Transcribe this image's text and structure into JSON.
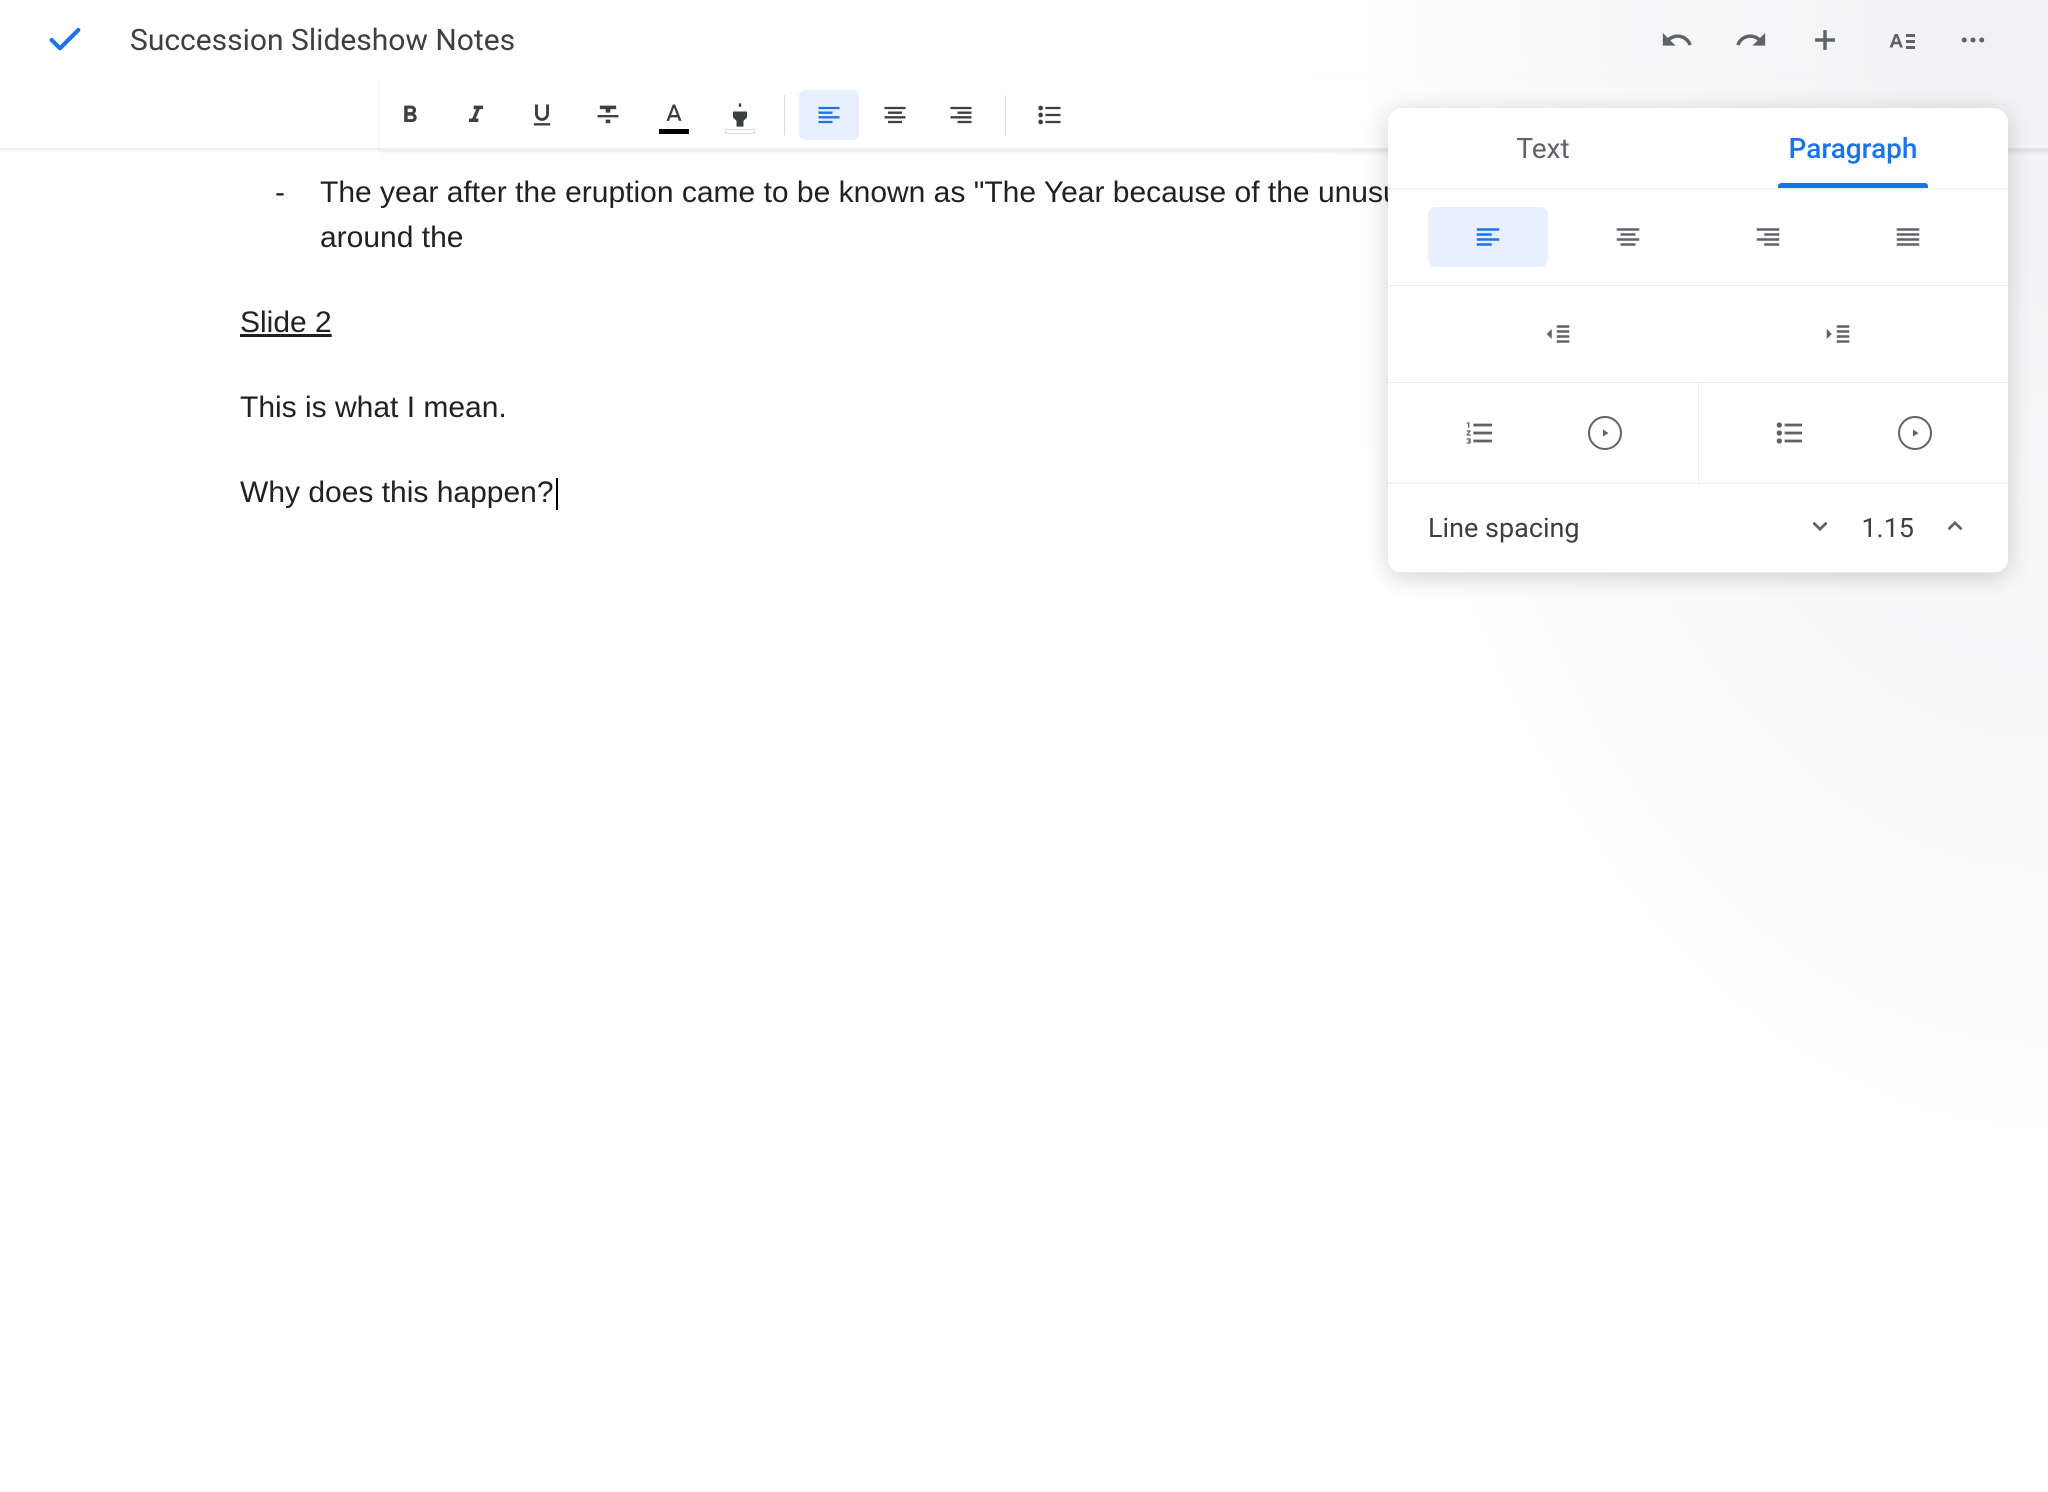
{
  "header": {
    "title": "Succession Slideshow Notes"
  },
  "document": {
    "bullet_text": "The year after the eruption came to be known as \"The Year because of the unusually cold temperatures all around the",
    "slide_heading": "Slide 2",
    "para1": "This is what I mean.",
    "para2": "Why does this happen?"
  },
  "panel": {
    "tab_text": "Text",
    "tab_paragraph": "Paragraph",
    "line_spacing_label": "Line spacing",
    "line_spacing_value": "1.15"
  }
}
